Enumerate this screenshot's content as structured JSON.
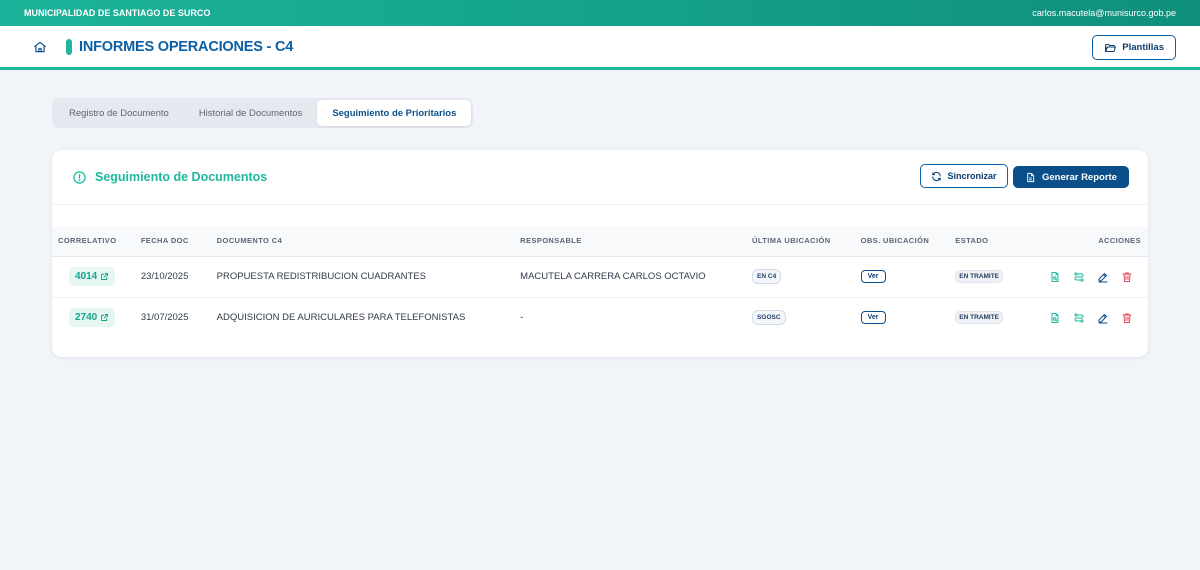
{
  "topbar": {
    "org": "MUNICIPALIDAD DE SANTIAGO DE SURCO",
    "user": "carlos.macutela@munisurco.gob.pe"
  },
  "header": {
    "title": "INFORMES OPERACIONES - C4",
    "plantillas_label": "Plantillas"
  },
  "tabs": [
    {
      "label": "Registro de Documento",
      "active": false
    },
    {
      "label": "Historial de Documentos",
      "active": false
    },
    {
      "label": "Seguimiento de Prioritarios",
      "active": true
    }
  ],
  "card": {
    "title": "Seguimiento de Documentos",
    "sync_label": "Sincronizar",
    "report_label": "Generar Reporte"
  },
  "table": {
    "headers": {
      "correlativo": "CORRELATIVO",
      "fecha": "FECHA DOC",
      "documento": "DOCUMENTO C4",
      "responsable": "RESPONSABLE",
      "ubicacion": "ÚLTIMA UBICACIÓN",
      "obs": "OBS. UBICACIÓN",
      "estado": "ESTADO",
      "acciones": "ACCIONES"
    },
    "rows": [
      {
        "correlativo": "4014",
        "fecha": "23/10/2025",
        "documento": "PROPUESTA REDISTRIBUCION CUADRANTES",
        "responsable": "MACUTELA CARRERA CARLOS OCTAVIO",
        "ubicacion": "EN C4",
        "obs": "Ver",
        "estado": "EN TRAMITE"
      },
      {
        "correlativo": "2740",
        "fecha": "31/07/2025",
        "documento": "ADQUISICION DE AURICULARES PARA TELEFONISTAS",
        "responsable": "-",
        "ubicacion": "SGOSC",
        "obs": "Ver",
        "estado": "EN TRAMITE"
      }
    ]
  },
  "colors": {
    "teal": "#1fb89e",
    "navy": "#0b4f8a",
    "danger": "#e0475a"
  },
  "icons": [
    "home-icon",
    "folder-open-icon",
    "info-circle-icon",
    "refresh-icon",
    "file-icon",
    "external-link-icon",
    "file-search-icon",
    "transfer-icon",
    "edit-icon",
    "trash-icon"
  ]
}
